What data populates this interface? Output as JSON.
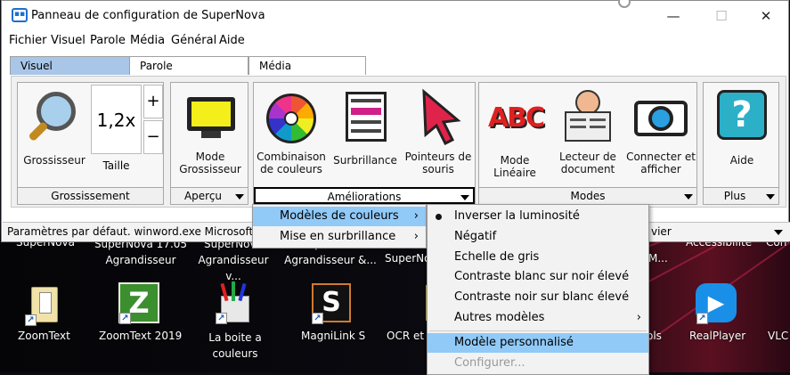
{
  "window": {
    "title": "Panneau de configuration de SuperNova",
    "minimize": "—",
    "maximize": "☐",
    "close": "✕"
  },
  "menubar": [
    "Fichier",
    "Visuel",
    "Parole",
    "Média",
    "Général",
    "Aide"
  ],
  "tabs": [
    "Visuel",
    "Parole",
    "Média"
  ],
  "ribbon": {
    "groups": {
      "grossissement": {
        "label": "Grossissement",
        "buttons": {
          "grossisseur": "Grossisseur",
          "taille": "Taille",
          "taille_value": "1,2x",
          "plus": "+",
          "minus": "−"
        }
      },
      "apercu": {
        "label": "Aperçu",
        "buttons": {
          "mode": "Mode Grossisseur"
        }
      },
      "ameliorations": {
        "label": "Améliorations",
        "buttons": {
          "combinaison": "Combinaison de couleurs",
          "surbrillance": "Surbrillance",
          "pointeurs": "Pointeurs de souris"
        }
      },
      "modes": {
        "label": "Modes",
        "buttons": {
          "lineaire": "Mode Linéaire",
          "lecteur": "Lecteur de document",
          "connecter": "Connecter et afficher"
        }
      },
      "plus": {
        "label": "Plus",
        "buttons": {
          "aide": "Aide"
        }
      }
    }
  },
  "status_bar": {
    "text": "Paramètres par défaut. winword.exe Microsoft W",
    "right_text": "vier"
  },
  "menu1": {
    "items": [
      {
        "label": "Modèles de couleurs",
        "submenu": "›"
      },
      {
        "label": "Mise en surbrillance",
        "submenu": "›"
      }
    ]
  },
  "menu2": {
    "items": [
      {
        "label": "Inverser la luminosité"
      },
      {
        "label": "Négatif"
      },
      {
        "label": "Echelle de gris"
      },
      {
        "label": "Contraste blanc sur noir élevé"
      },
      {
        "label": "Contraste noir sur blanc élevé"
      },
      {
        "label": "Autres modèles",
        "submenu": "›"
      },
      {
        "label": "Modèle personnalisé"
      },
      {
        "label": "Configurer..."
      }
    ]
  },
  "desktop": {
    "top_row": [
      "SuperNova",
      "SuperNova 17.05 Agrandisseur",
      "SuperNova Agrandisseur v...",
      "SuperNova Agrandisseur &...",
      "SuperNo",
      "Accessibilité",
      "Con",
      "M..."
    ],
    "icons": [
      "ZoomText",
      "ZoomText 2019",
      "La boite a couleurs",
      "MagniLink S",
      "OCR et",
      "ols",
      "RealPlayer",
      "VLC"
    ],
    "icon_glyphs": {
      "zoomtext2019": "Z",
      "magnilink": "S"
    }
  },
  "colors": {
    "tab_active": "#a9c6e8",
    "menu_highlight": "#91c9f7",
    "desktop_bg": "#0b0b12"
  }
}
